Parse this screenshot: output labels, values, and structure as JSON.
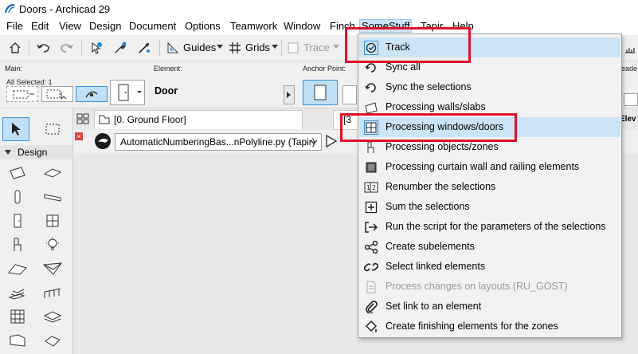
{
  "window": {
    "title": "Doors - Archicad 29",
    "app_icon": "archicad-logo-icon"
  },
  "menubar": {
    "items": [
      {
        "label": "File"
      },
      {
        "label": "Edit"
      },
      {
        "label": "View"
      },
      {
        "label": "Design"
      },
      {
        "label": "Document"
      },
      {
        "label": "Options"
      },
      {
        "label": "Teamwork"
      },
      {
        "label": "Window"
      },
      {
        "label": "Finch"
      },
      {
        "label": "SomeStuff",
        "active": true
      },
      {
        "label": "Tapir"
      },
      {
        "label": "Help"
      }
    ]
  },
  "toolbar": {
    "guides_label": "Guides",
    "grids_label": "Grids",
    "trace_label": "Trace"
  },
  "infobox": {
    "main_caption": "Main:",
    "all_selected": "All Selected: 1",
    "element_caption": "Element:",
    "element_value": "Door",
    "anchor_caption": "Anchor Point:",
    "right_cut_caption": "eade",
    "right_cut_value": "Elev"
  },
  "toolbox": {
    "section_label": "Design"
  },
  "tabbar": {
    "tab_label": "[0. Ground Floor]",
    "tab2_label": "[3"
  },
  "scriptbar": {
    "script_value": "AutomaticNumberingBas...nPolyline.py (Tapir)"
  },
  "menu": {
    "accent": "#e0102a",
    "highlight": "#cce4f7",
    "items": [
      {
        "label": "Track",
        "icon": "track-icon",
        "highlighted": true
      },
      {
        "label": "Sync all",
        "icon": "sync-all-icon"
      },
      {
        "label": "Sync the selections",
        "icon": "sync-selection-icon"
      },
      {
        "label": "Processing walls/slabs",
        "icon": "wall-slab-icon"
      },
      {
        "label": "Processing windows/doors",
        "icon": "window-door-icon",
        "highlighted": true
      },
      {
        "label": "Processing objects/zones",
        "icon": "object-zone-icon"
      },
      {
        "label": "Processing curtain wall and railing elements",
        "icon": "curtain-wall-icon"
      },
      {
        "label": "Renumber the selections",
        "icon": "renumber-icon"
      },
      {
        "label": "Sum the selections",
        "icon": "sum-icon"
      },
      {
        "label": "Run the script for the parameters of the selections",
        "icon": "run-script-icon"
      },
      {
        "label": "Create subelements",
        "icon": "subelements-icon"
      },
      {
        "label": "Select linked elements",
        "icon": "linked-elements-icon"
      },
      {
        "label": "Process changes on layouts (RU_GOST)",
        "icon": "layouts-icon",
        "disabled": true
      },
      {
        "label": "Set link to an element",
        "icon": "link-icon"
      },
      {
        "label": "Create finishing elements for the zones",
        "icon": "finishing-icon"
      }
    ]
  }
}
